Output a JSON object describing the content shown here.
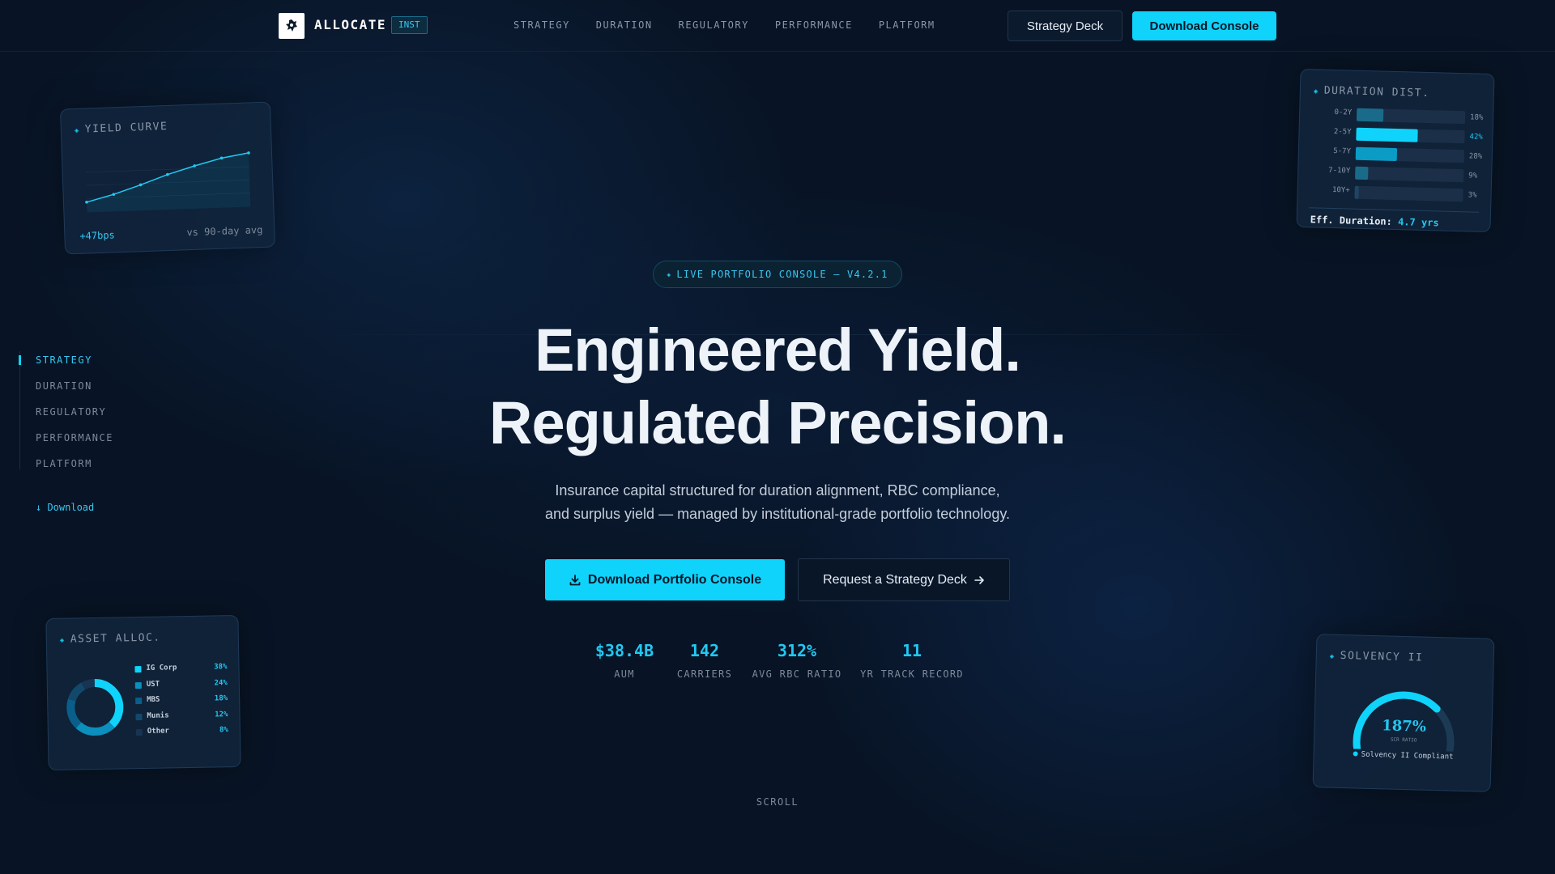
{
  "nav": {
    "brand": "ALLOCATE",
    "brand_badge": "INST",
    "links": [
      "STRATEGY",
      "DURATION",
      "REGULATORY",
      "PERFORMANCE",
      "PLATFORM"
    ],
    "deck_button": "Strategy Deck",
    "console_button": "Download Console"
  },
  "side_nav": {
    "items": [
      "STRATEGY",
      "DURATION",
      "REGULATORY",
      "PERFORMANCE",
      "PLATFORM"
    ],
    "active": "STRATEGY",
    "download": "↓ Download"
  },
  "hero": {
    "badge": "LIVE PORTFOLIO CONSOLE — V4.2.1",
    "title_line1": "Engineered Yield.",
    "title_line2": "Regulated Precision.",
    "subtitle_line1": "Insurance capital structured for duration alignment, RBC compliance,",
    "subtitle_line2": "and surplus yield — managed by institutional-grade portfolio technology.",
    "cta_primary": "Download Portfolio Console",
    "cta_secondary": "Request a Strategy Deck"
  },
  "stats": [
    {
      "value": "$38.4B",
      "label": "AUM"
    },
    {
      "value": "142",
      "label": "CARRIERS"
    },
    {
      "value": "312%",
      "label": "AVG RBC RATIO"
    },
    {
      "value": "11",
      "label": "YR TRACK RECORD"
    }
  ],
  "scroll_label": "SCROLL",
  "cards": {
    "yield_curve": {
      "title": "YIELD CURVE",
      "delta": "+47bps",
      "comparison": "vs 90-day avg",
      "points": [
        1.2,
        2.0,
        3.0,
        4.1,
        5.0,
        5.8,
        6.3
      ]
    },
    "duration": {
      "title": "DURATION DIST.",
      "rows": [
        {
          "label": "0-2Y",
          "pct": 18,
          "text": "18%"
        },
        {
          "label": "2-5Y",
          "pct": 42,
          "text": "42%"
        },
        {
          "label": "5-7Y",
          "pct": 28,
          "text": "28%"
        },
        {
          "label": "7-10Y",
          "pct": 9,
          "text": "9%"
        },
        {
          "label": "10Y+",
          "pct": 3,
          "text": "3%"
        }
      ],
      "effective_label": "Eff. Duration:",
      "effective_value": "4.7 yrs"
    },
    "asset_alloc": {
      "title": "ASSET ALLOC.",
      "rows": [
        {
          "name": "IG Corp",
          "pct": 38,
          "text": "38%",
          "color": "#0fd3fa"
        },
        {
          "name": "UST",
          "pct": 24,
          "text": "24%",
          "color": "#0b8fbd"
        },
        {
          "name": "MBS",
          "pct": 18,
          "text": "18%",
          "color": "#0a5f8a"
        },
        {
          "name": "Munis",
          "pct": 12,
          "text": "12%",
          "color": "#12496b"
        },
        {
          "name": "Other",
          "pct": 8,
          "text": "8%",
          "color": "#173552"
        }
      ]
    },
    "solvency": {
      "title": "SOLVENCY II",
      "value": "187%",
      "level": 0.72,
      "note": "SCR RATIO",
      "compliance": "Solvency II Compliant"
    }
  },
  "colors": {
    "accent": "#0fd3fa",
    "background": "#081425",
    "text_muted": "#8a97a8"
  }
}
